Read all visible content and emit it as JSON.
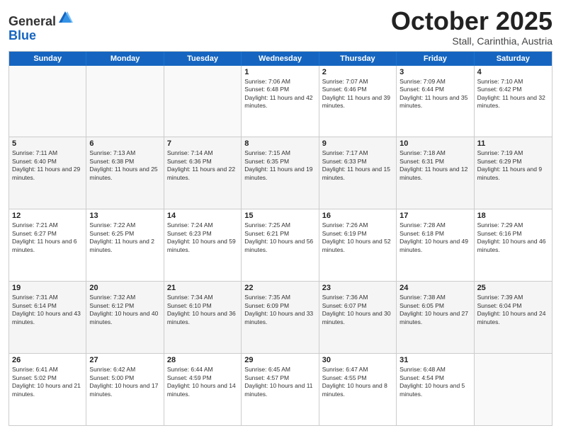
{
  "header": {
    "logo_general": "General",
    "logo_blue": "Blue",
    "month_title": "October 2025",
    "subtitle": "Stall, Carinthia, Austria"
  },
  "days_of_week": [
    "Sunday",
    "Monday",
    "Tuesday",
    "Wednesday",
    "Thursday",
    "Friday",
    "Saturday"
  ],
  "rows": [
    [
      {
        "day": "",
        "empty": true
      },
      {
        "day": "",
        "empty": true
      },
      {
        "day": "",
        "empty": true
      },
      {
        "day": "1",
        "sunrise": "Sunrise: 7:06 AM",
        "sunset": "Sunset: 6:48 PM",
        "daylight": "Daylight: 11 hours and 42 minutes."
      },
      {
        "day": "2",
        "sunrise": "Sunrise: 7:07 AM",
        "sunset": "Sunset: 6:46 PM",
        "daylight": "Daylight: 11 hours and 39 minutes."
      },
      {
        "day": "3",
        "sunrise": "Sunrise: 7:09 AM",
        "sunset": "Sunset: 6:44 PM",
        "daylight": "Daylight: 11 hours and 35 minutes."
      },
      {
        "day": "4",
        "sunrise": "Sunrise: 7:10 AM",
        "sunset": "Sunset: 6:42 PM",
        "daylight": "Daylight: 11 hours and 32 minutes."
      }
    ],
    [
      {
        "day": "5",
        "sunrise": "Sunrise: 7:11 AM",
        "sunset": "Sunset: 6:40 PM",
        "daylight": "Daylight: 11 hours and 29 minutes."
      },
      {
        "day": "6",
        "sunrise": "Sunrise: 7:13 AM",
        "sunset": "Sunset: 6:38 PM",
        "daylight": "Daylight: 11 hours and 25 minutes."
      },
      {
        "day": "7",
        "sunrise": "Sunrise: 7:14 AM",
        "sunset": "Sunset: 6:36 PM",
        "daylight": "Daylight: 11 hours and 22 minutes."
      },
      {
        "day": "8",
        "sunrise": "Sunrise: 7:15 AM",
        "sunset": "Sunset: 6:35 PM",
        "daylight": "Daylight: 11 hours and 19 minutes."
      },
      {
        "day": "9",
        "sunrise": "Sunrise: 7:17 AM",
        "sunset": "Sunset: 6:33 PM",
        "daylight": "Daylight: 11 hours and 15 minutes."
      },
      {
        "day": "10",
        "sunrise": "Sunrise: 7:18 AM",
        "sunset": "Sunset: 6:31 PM",
        "daylight": "Daylight: 11 hours and 12 minutes."
      },
      {
        "day": "11",
        "sunrise": "Sunrise: 7:19 AM",
        "sunset": "Sunset: 6:29 PM",
        "daylight": "Daylight: 11 hours and 9 minutes."
      }
    ],
    [
      {
        "day": "12",
        "sunrise": "Sunrise: 7:21 AM",
        "sunset": "Sunset: 6:27 PM",
        "daylight": "Daylight: 11 hours and 6 minutes."
      },
      {
        "day": "13",
        "sunrise": "Sunrise: 7:22 AM",
        "sunset": "Sunset: 6:25 PM",
        "daylight": "Daylight: 11 hours and 2 minutes."
      },
      {
        "day": "14",
        "sunrise": "Sunrise: 7:24 AM",
        "sunset": "Sunset: 6:23 PM",
        "daylight": "Daylight: 10 hours and 59 minutes."
      },
      {
        "day": "15",
        "sunrise": "Sunrise: 7:25 AM",
        "sunset": "Sunset: 6:21 PM",
        "daylight": "Daylight: 10 hours and 56 minutes."
      },
      {
        "day": "16",
        "sunrise": "Sunrise: 7:26 AM",
        "sunset": "Sunset: 6:19 PM",
        "daylight": "Daylight: 10 hours and 52 minutes."
      },
      {
        "day": "17",
        "sunrise": "Sunrise: 7:28 AM",
        "sunset": "Sunset: 6:18 PM",
        "daylight": "Daylight: 10 hours and 49 minutes."
      },
      {
        "day": "18",
        "sunrise": "Sunrise: 7:29 AM",
        "sunset": "Sunset: 6:16 PM",
        "daylight": "Daylight: 10 hours and 46 minutes."
      }
    ],
    [
      {
        "day": "19",
        "sunrise": "Sunrise: 7:31 AM",
        "sunset": "Sunset: 6:14 PM",
        "daylight": "Daylight: 10 hours and 43 minutes."
      },
      {
        "day": "20",
        "sunrise": "Sunrise: 7:32 AM",
        "sunset": "Sunset: 6:12 PM",
        "daylight": "Daylight: 10 hours and 40 minutes."
      },
      {
        "day": "21",
        "sunrise": "Sunrise: 7:34 AM",
        "sunset": "Sunset: 6:10 PM",
        "daylight": "Daylight: 10 hours and 36 minutes."
      },
      {
        "day": "22",
        "sunrise": "Sunrise: 7:35 AM",
        "sunset": "Sunset: 6:09 PM",
        "daylight": "Daylight: 10 hours and 33 minutes."
      },
      {
        "day": "23",
        "sunrise": "Sunrise: 7:36 AM",
        "sunset": "Sunset: 6:07 PM",
        "daylight": "Daylight: 10 hours and 30 minutes."
      },
      {
        "day": "24",
        "sunrise": "Sunrise: 7:38 AM",
        "sunset": "Sunset: 6:05 PM",
        "daylight": "Daylight: 10 hours and 27 minutes."
      },
      {
        "day": "25",
        "sunrise": "Sunrise: 7:39 AM",
        "sunset": "Sunset: 6:04 PM",
        "daylight": "Daylight: 10 hours and 24 minutes."
      }
    ],
    [
      {
        "day": "26",
        "sunrise": "Sunrise: 6:41 AM",
        "sunset": "Sunset: 5:02 PM",
        "daylight": "Daylight: 10 hours and 21 minutes."
      },
      {
        "day": "27",
        "sunrise": "Sunrise: 6:42 AM",
        "sunset": "Sunset: 5:00 PM",
        "daylight": "Daylight: 10 hours and 17 minutes."
      },
      {
        "day": "28",
        "sunrise": "Sunrise: 6:44 AM",
        "sunset": "Sunset: 4:59 PM",
        "daylight": "Daylight: 10 hours and 14 minutes."
      },
      {
        "day": "29",
        "sunrise": "Sunrise: 6:45 AM",
        "sunset": "Sunset: 4:57 PM",
        "daylight": "Daylight: 10 hours and 11 minutes."
      },
      {
        "day": "30",
        "sunrise": "Sunrise: 6:47 AM",
        "sunset": "Sunset: 4:55 PM",
        "daylight": "Daylight: 10 hours and 8 minutes."
      },
      {
        "day": "31",
        "sunrise": "Sunrise: 6:48 AM",
        "sunset": "Sunset: 4:54 PM",
        "daylight": "Daylight: 10 hours and 5 minutes."
      },
      {
        "day": "",
        "empty": true
      }
    ]
  ]
}
